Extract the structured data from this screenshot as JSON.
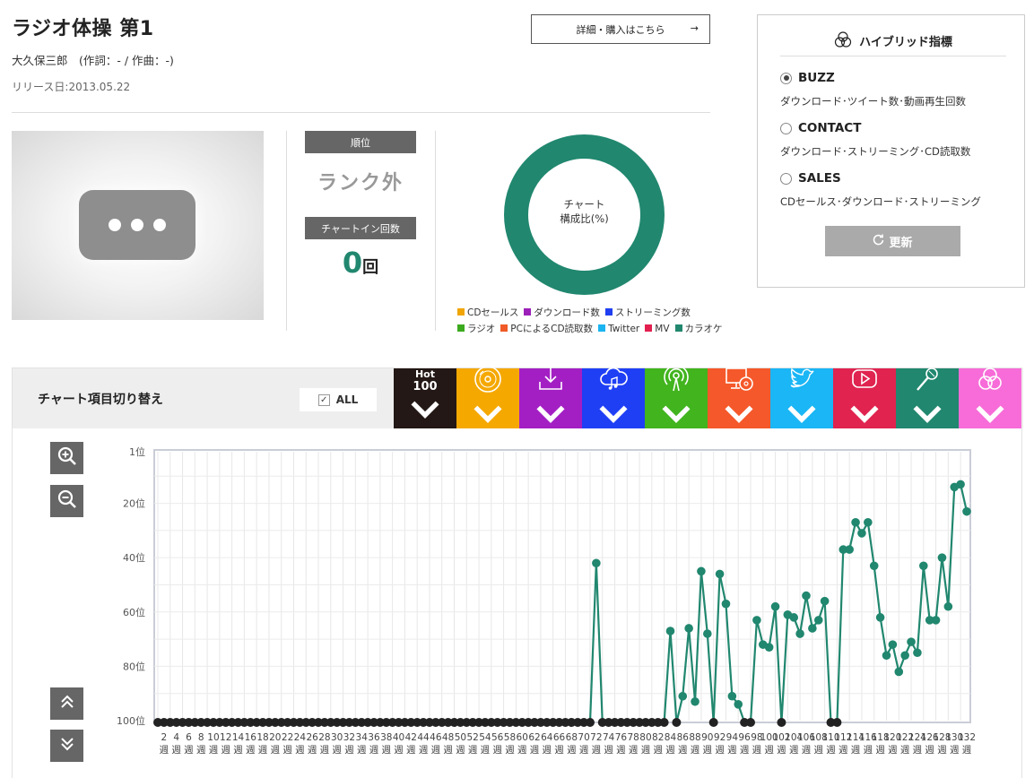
{
  "song": {
    "title": "ラジオ体操 第1",
    "artist_line": "大久保三郎　(作詞：- / 作曲：-)",
    "release": "リリース日:2013.05.22",
    "buy_label": "詳細・購入はこちら",
    "buy_arrow": "→"
  },
  "stats": {
    "rank_label": "順位",
    "rank_value": "ランク外",
    "chartin_label": "チャートイン回数",
    "chartin_count": "0",
    "chartin_unit": "回"
  },
  "donut": {
    "line1": "チャート",
    "line2": "構成比(%)",
    "color": "#21876f"
  },
  "legend": [
    {
      "label": "CDセールス",
      "color": "#f0a500"
    },
    {
      "label": "ダウンロード数",
      "color": "#9b1fb8"
    },
    {
      "label": "ストリーミング数",
      "color": "#1f3ff0"
    },
    {
      "label": "ラジオ",
      "color": "#3caa1e"
    },
    {
      "label": "PCによるCD読取数",
      "color": "#f05a28"
    },
    {
      "label": "Twitter",
      "color": "#1ab4f0"
    },
    {
      "label": "MV",
      "color": "#e21f4f"
    },
    {
      "label": "カラオケ",
      "color": "#21876f"
    }
  ],
  "hybrid": {
    "title": "ハイブリッド指標",
    "options": [
      {
        "label": "BUZZ",
        "desc": "ダウンロード･ツイート数･動画再生回数",
        "selected": true
      },
      {
        "label": "CONTACT",
        "desc": "ダウンロード･ストリーミング･CD読取数",
        "selected": false
      },
      {
        "label": "SALES",
        "desc": "CDセールス･ダウンロード･ストリーミング",
        "selected": false
      }
    ],
    "refresh_label": "更新"
  },
  "switcher": {
    "title": "チャート項目切り替え",
    "all_label": "ALL",
    "hot_line1": "Hot",
    "hot_line2": "100",
    "categories": [
      {
        "icon": "hot100-icon",
        "color": "#231815"
      },
      {
        "icon": "cd-icon",
        "color": "#f5a800"
      },
      {
        "icon": "download-icon",
        "color": "#a31fc4"
      },
      {
        "icon": "streaming-icon",
        "color": "#1f3ff5"
      },
      {
        "icon": "radio-icon",
        "color": "#41b41e"
      },
      {
        "icon": "pc-cd-icon",
        "color": "#f5582a"
      },
      {
        "icon": "twitter-icon",
        "color": "#1ab6f5"
      },
      {
        "icon": "mv-icon",
        "color": "#e0234f"
      },
      {
        "icon": "karaoke-icon",
        "color": "#21876f"
      },
      {
        "icon": "hybrid-icon",
        "color": "#f76cd8"
      }
    ]
  },
  "chart_data": {
    "type": "line",
    "series_color": "#21876f",
    "baseline_color": "#222222",
    "ylim": [
      1,
      100
    ],
    "y_reversed": true,
    "y_ticks": [
      {
        "value": 1,
        "label": "1位"
      },
      {
        "value": 20,
        "label": "20位"
      },
      {
        "value": 40,
        "label": "40位"
      },
      {
        "value": 60,
        "label": "60位"
      },
      {
        "value": 80,
        "label": "80位"
      },
      {
        "value": 100,
        "label": "100位"
      }
    ],
    "week_unit": "週",
    "x_labels": [
      "2",
      "4",
      "6",
      "8",
      "10",
      "12",
      "14",
      "16",
      "18",
      "20",
      "22",
      "24",
      "26",
      "28",
      "30",
      "32",
      "34",
      "36",
      "38",
      "40",
      "42",
      "44",
      "46",
      "48",
      "50",
      "52",
      "54",
      "56",
      "58",
      "60",
      "62",
      "64",
      "66",
      "68",
      "70",
      "72",
      "74",
      "76",
      "78",
      "80",
      "82",
      "84",
      "86",
      "88",
      "90",
      "92",
      "94",
      "96",
      "98",
      "100",
      "102",
      "104",
      "106",
      "108",
      "110",
      "112",
      "114",
      "116",
      "118",
      "120",
      "122",
      "124",
      "126",
      "128",
      "130",
      "132"
    ],
    "points": [
      {
        "week": 1,
        "rank": null
      },
      {
        "week": 2,
        "rank": null
      },
      {
        "week": 3,
        "rank": null
      },
      {
        "week": 4,
        "rank": null
      },
      {
        "week": 5,
        "rank": null
      },
      {
        "week": 6,
        "rank": null
      },
      {
        "week": 7,
        "rank": null
      },
      {
        "week": 8,
        "rank": null
      },
      {
        "week": 9,
        "rank": null
      },
      {
        "week": 10,
        "rank": null
      },
      {
        "week": 11,
        "rank": null
      },
      {
        "week": 12,
        "rank": null
      },
      {
        "week": 13,
        "rank": null
      },
      {
        "week": 14,
        "rank": null
      },
      {
        "week": 15,
        "rank": null
      },
      {
        "week": 16,
        "rank": null
      },
      {
        "week": 17,
        "rank": null
      },
      {
        "week": 18,
        "rank": null
      },
      {
        "week": 19,
        "rank": null
      },
      {
        "week": 20,
        "rank": null
      },
      {
        "week": 21,
        "rank": null
      },
      {
        "week": 22,
        "rank": null
      },
      {
        "week": 23,
        "rank": null
      },
      {
        "week": 24,
        "rank": null
      },
      {
        "week": 25,
        "rank": null
      },
      {
        "week": 26,
        "rank": null
      },
      {
        "week": 27,
        "rank": null
      },
      {
        "week": 28,
        "rank": null
      },
      {
        "week": 29,
        "rank": null
      },
      {
        "week": 30,
        "rank": null
      },
      {
        "week": 31,
        "rank": null
      },
      {
        "week": 32,
        "rank": null
      },
      {
        "week": 33,
        "rank": null
      },
      {
        "week": 34,
        "rank": null
      },
      {
        "week": 35,
        "rank": null
      },
      {
        "week": 36,
        "rank": null
      },
      {
        "week": 37,
        "rank": null
      },
      {
        "week": 38,
        "rank": null
      },
      {
        "week": 39,
        "rank": null
      },
      {
        "week": 40,
        "rank": null
      },
      {
        "week": 41,
        "rank": null
      },
      {
        "week": 42,
        "rank": null
      },
      {
        "week": 43,
        "rank": null
      },
      {
        "week": 44,
        "rank": null
      },
      {
        "week": 45,
        "rank": null
      },
      {
        "week": 46,
        "rank": null
      },
      {
        "week": 47,
        "rank": null
      },
      {
        "week": 48,
        "rank": null
      },
      {
        "week": 49,
        "rank": null
      },
      {
        "week": 50,
        "rank": null
      },
      {
        "week": 51,
        "rank": null
      },
      {
        "week": 52,
        "rank": null
      },
      {
        "week": 53,
        "rank": null
      },
      {
        "week": 54,
        "rank": null
      },
      {
        "week": 55,
        "rank": null
      },
      {
        "week": 56,
        "rank": null
      },
      {
        "week": 57,
        "rank": null
      },
      {
        "week": 58,
        "rank": null
      },
      {
        "week": 59,
        "rank": null
      },
      {
        "week": 60,
        "rank": null
      },
      {
        "week": 61,
        "rank": null
      },
      {
        "week": 62,
        "rank": null
      },
      {
        "week": 63,
        "rank": null
      },
      {
        "week": 64,
        "rank": null
      },
      {
        "week": 65,
        "rank": null
      },
      {
        "week": 66,
        "rank": null
      },
      {
        "week": 67,
        "rank": null
      },
      {
        "week": 68,
        "rank": null
      },
      {
        "week": 69,
        "rank": null
      },
      {
        "week": 70,
        "rank": null
      },
      {
        "week": 71,
        "rank": null
      },
      {
        "week": 72,
        "rank": 42
      },
      {
        "week": 73,
        "rank": null
      },
      {
        "week": 74,
        "rank": null
      },
      {
        "week": 75,
        "rank": null
      },
      {
        "week": 76,
        "rank": null
      },
      {
        "week": 77,
        "rank": null
      },
      {
        "week": 78,
        "rank": null
      },
      {
        "week": 79,
        "rank": null
      },
      {
        "week": 80,
        "rank": null
      },
      {
        "week": 81,
        "rank": null
      },
      {
        "week": 82,
        "rank": null
      },
      {
        "week": 83,
        "rank": null
      },
      {
        "week": 84,
        "rank": 67
      },
      {
        "week": 85,
        "rank": null
      },
      {
        "week": 86,
        "rank": 91
      },
      {
        "week": 87,
        "rank": 66
      },
      {
        "week": 88,
        "rank": 93
      },
      {
        "week": 89,
        "rank": 45
      },
      {
        "week": 90,
        "rank": 68
      },
      {
        "week": 91,
        "rank": null
      },
      {
        "week": 92,
        "rank": 46
      },
      {
        "week": 93,
        "rank": 57
      },
      {
        "week": 94,
        "rank": 91
      },
      {
        "week": 95,
        "rank": 94
      },
      {
        "week": 96,
        "rank": null
      },
      {
        "week": 97,
        "rank": null
      },
      {
        "week": 98,
        "rank": 63
      },
      {
        "week": 99,
        "rank": 72
      },
      {
        "week": 100,
        "rank": 73
      },
      {
        "week": 101,
        "rank": 58
      },
      {
        "week": 102,
        "rank": null
      },
      {
        "week": 103,
        "rank": 61
      },
      {
        "week": 104,
        "rank": 62
      },
      {
        "week": 105,
        "rank": 68
      },
      {
        "week": 106,
        "rank": 54
      },
      {
        "week": 107,
        "rank": 66
      },
      {
        "week": 108,
        "rank": 63
      },
      {
        "week": 109,
        "rank": 56
      },
      {
        "week": 110,
        "rank": null
      },
      {
        "week": 111,
        "rank": null
      },
      {
        "week": 112,
        "rank": 37
      },
      {
        "week": 113,
        "rank": 37
      },
      {
        "week": 114,
        "rank": 27
      },
      {
        "week": 115,
        "rank": 31
      },
      {
        "week": 116,
        "rank": 27
      },
      {
        "week": 117,
        "rank": 43
      },
      {
        "week": 118,
        "rank": 62
      },
      {
        "week": 119,
        "rank": 76
      },
      {
        "week": 120,
        "rank": 72
      },
      {
        "week": 121,
        "rank": 82
      },
      {
        "week": 122,
        "rank": 76
      },
      {
        "week": 123,
        "rank": 71
      },
      {
        "week": 124,
        "rank": 75
      },
      {
        "week": 125,
        "rank": 43
      },
      {
        "week": 126,
        "rank": 63
      },
      {
        "week": 127,
        "rank": 63
      },
      {
        "week": 128,
        "rank": 40
      },
      {
        "week": 129,
        "rank": 58
      },
      {
        "week": 130,
        "rank": 14
      },
      {
        "week": 131,
        "rank": 13
      },
      {
        "week": 132,
        "rank": 23
      }
    ]
  }
}
